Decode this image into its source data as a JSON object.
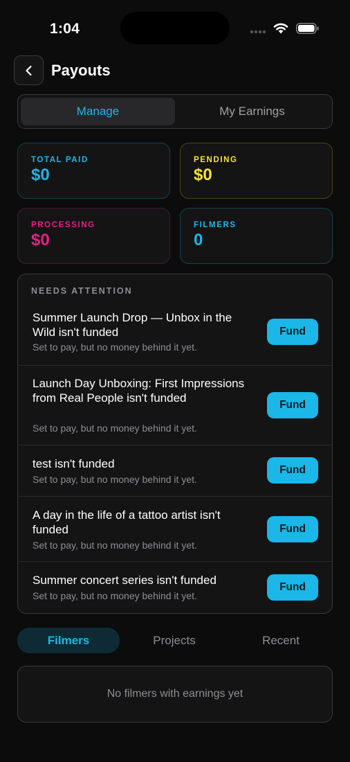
{
  "status": {
    "time": "1:04"
  },
  "header": {
    "title": "Payouts"
  },
  "segment": {
    "items": [
      "Manage",
      "My Earnings"
    ],
    "selected": "Manage"
  },
  "stats": [
    {
      "label": "TOTAL PAID",
      "value": "$0",
      "color": "#1ab7e8"
    },
    {
      "label": "PENDING",
      "value": "$0",
      "color": "#f5e332"
    },
    {
      "label": "PROCESSING",
      "value": "$0",
      "color": "#e51f87"
    },
    {
      "label": "FILMERS",
      "value": "0",
      "color": "#1ab7e8"
    }
  ],
  "attention": {
    "title": "NEEDS ATTENTION",
    "items": [
      {
        "title": "Summer Launch Drop — Unbox in the Wild isn't funded",
        "subtitle": "Set to pay, but no money behind it yet.",
        "button": "Fund"
      },
      {
        "title": "Launch Day Unboxing: First Impressions from Real People isn't funded",
        "subtitle": "Set to pay, but no money behind it yet.",
        "button": "Fund"
      },
      {
        "title": "test isn't funded",
        "subtitle": "Set to pay, but no money behind it yet.",
        "button": "Fund"
      },
      {
        "title": "A day in the life of a tattoo artist isn't funded",
        "subtitle": "Set to pay, but no money behind it yet.",
        "button": "Fund"
      },
      {
        "title": "Summer concert series isn't funded",
        "subtitle": "Set to pay, but no money behind it yet.",
        "button": "Fund"
      }
    ]
  },
  "tabs": {
    "items": [
      "Filmers",
      "Projects",
      "Recent"
    ],
    "selected": "Filmers"
  },
  "empty_state": {
    "text": "No filmers with earnings yet"
  },
  "colors": {
    "accent": "#1ab7e8",
    "pending": "#f5e332",
    "processing": "#e51f87",
    "background": "#0c0c0d"
  }
}
